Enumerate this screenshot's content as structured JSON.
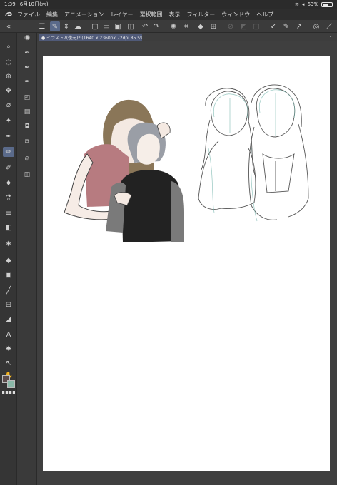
{
  "status": {
    "time": "1:39",
    "date": "6月10日(木)",
    "battery": "63%",
    "battery_level": 0.63
  },
  "menu": [
    "ファイル",
    "編集",
    "アニメーション",
    "レイヤー",
    "選択範囲",
    "表示",
    "フィルター",
    "ウィンドウ",
    "ヘルプ"
  ],
  "document": {
    "tab_title": "● イラスト7(復元)* (1640 x 2360px 72dpi 85.5%)"
  },
  "colors": {
    "main_color": "#5a4a4a",
    "sub_color": "#8ab8a8",
    "accent": "#5a6a8a"
  },
  "icons": {
    "toolbar": [
      "menu-icon",
      "snap-icon",
      "updown-icon",
      "cloud-icon",
      "new-icon",
      "open-icon",
      "save-icon",
      "export-icon",
      "undo-icon",
      "redo-icon",
      "spinner-icon",
      "crop-icon",
      "fill-icon",
      "ruler-icon",
      "layer-icon",
      "select-icon",
      "pen-check-icon",
      "pen-icon",
      "transform-icon",
      "more-icon"
    ],
    "tools": [
      "zoom-icon",
      "move-icon",
      "lasso-icon",
      "move-layer-icon",
      "eyedropper-icon",
      "magic-wand-icon",
      "picker-icon",
      "pen-tool-icon",
      "pencil-icon",
      "brush-icon",
      "blend-icon",
      "eraser-icon",
      "blur-icon",
      "bucket-icon",
      "gradient-icon",
      "line-icon",
      "frame-icon",
      "ruler-tool-icon",
      "text-icon",
      "burst-icon",
      "pointer-icon",
      "hand-icon"
    ]
  }
}
